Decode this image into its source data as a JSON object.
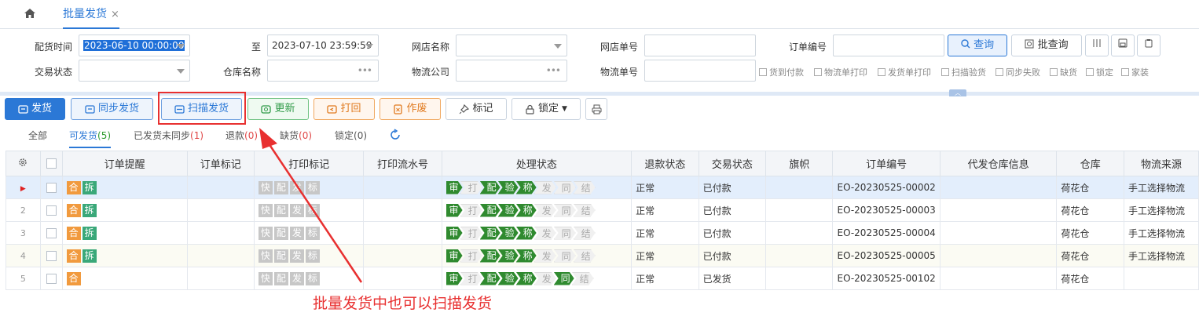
{
  "tabs": {
    "home_icon": "home-icon",
    "active_tab": "批量发货",
    "close": "×"
  },
  "filters": {
    "row1": [
      {
        "label": "配货时间",
        "value": "2023-06-10 00:00:00"
      },
      {
        "label": "至",
        "value": "2023-07-10 23:59:59"
      },
      {
        "label": "网店名称",
        "value": ""
      },
      {
        "label": "网店单号",
        "value": ""
      },
      {
        "label": "订单编号",
        "value": ""
      }
    ],
    "row2": [
      {
        "label": "交易状态",
        "value": ""
      },
      {
        "label": "仓库名称",
        "value": ""
      },
      {
        "label": "物流公司",
        "value": ""
      },
      {
        "label": "物流单号",
        "value": ""
      }
    ],
    "query_button": "查询",
    "batch_query_button": "批查询",
    "checkboxes": [
      "货到付款",
      "物流单打印",
      "发货单打印",
      "扫描验货",
      "同步失败",
      "缺货",
      "锁定",
      "家装"
    ]
  },
  "actions": {
    "ship": "发货",
    "sync_ship": "同步发货",
    "scan_ship": "扫描发货",
    "update": "更新",
    "print_back": "打回",
    "void": "作废",
    "mark": "标记",
    "lock": "锁定"
  },
  "subtabs": [
    {
      "label": "全部",
      "count": ""
    },
    {
      "label": "可发货",
      "count": "(5)"
    },
    {
      "label": "已发货未同步",
      "count": "(1)"
    },
    {
      "label": "退款",
      "count": "(0)"
    },
    {
      "label": "缺货",
      "count": "(0)"
    },
    {
      "label": "锁定",
      "count": "(0)"
    }
  ],
  "table": {
    "headers": [
      "订单提醒",
      "订单标记",
      "打印标记",
      "打印流水号",
      "处理状态",
      "退款状态",
      "交易状态",
      "旗帜",
      "订单编号",
      "代发仓库信息",
      "仓库",
      "物流来源"
    ],
    "print_tags": [
      "快",
      "配",
      "发",
      "标"
    ],
    "status_steps": [
      "审",
      "打",
      "配",
      "验",
      "称",
      "发",
      "同",
      "结"
    ],
    "rows": [
      {
        "num": "▶",
        "remind": [
          "合",
          "拆"
        ],
        "steps_on": [
          true,
          false,
          true,
          true,
          true,
          false,
          false,
          false
        ],
        "refund": "正常",
        "trade": "已付款",
        "order": "EO-20230525-00002",
        "warehouse": "荷花仓",
        "logistics": "手工选择物流"
      },
      {
        "num": "2",
        "remind": [
          "合",
          "拆"
        ],
        "steps_on": [
          true,
          false,
          true,
          true,
          true,
          false,
          false,
          false
        ],
        "refund": "正常",
        "trade": "已付款",
        "order": "EO-20230525-00003",
        "warehouse": "荷花仓",
        "logistics": "手工选择物流"
      },
      {
        "num": "3",
        "remind": [
          "合",
          "拆"
        ],
        "steps_on": [
          true,
          false,
          true,
          true,
          true,
          false,
          false,
          false
        ],
        "refund": "正常",
        "trade": "已付款",
        "order": "EO-20230525-00004",
        "warehouse": "荷花仓",
        "logistics": "手工选择物流"
      },
      {
        "num": "4",
        "remind": [
          "合",
          "拆"
        ],
        "steps_on": [
          true,
          false,
          true,
          true,
          true,
          false,
          false,
          false
        ],
        "refund": "正常",
        "trade": "已付款",
        "order": "EO-20230525-00005",
        "warehouse": "荷花仓",
        "logistics": "手工选择物流"
      },
      {
        "num": "5",
        "remind": [
          "合"
        ],
        "steps_on": [
          true,
          false,
          true,
          true,
          true,
          false,
          true,
          false
        ],
        "refund": "正常",
        "trade": "已发货",
        "order": "EO-20230525-00102",
        "warehouse": "荷花仓",
        "logistics": ""
      }
    ]
  },
  "annotation": "批量发货中也可以扫描发货",
  "colors": {
    "accent": "#2b78d6",
    "annotation": "#e83030",
    "step_on": "#2f8a2f",
    "tag_orange": "#f19a3e",
    "tag_green": "#3aa879"
  }
}
